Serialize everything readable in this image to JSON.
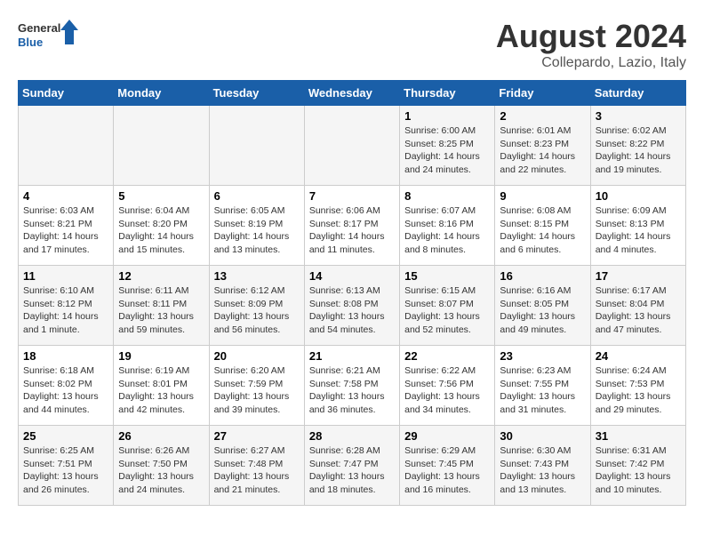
{
  "header": {
    "logo_general": "General",
    "logo_blue": "Blue",
    "title": "August 2024",
    "subtitle": "Collepardo, Lazio, Italy"
  },
  "days_of_week": [
    "Sunday",
    "Monday",
    "Tuesday",
    "Wednesday",
    "Thursday",
    "Friday",
    "Saturday"
  ],
  "weeks": [
    {
      "days": [
        {
          "num": "",
          "info": ""
        },
        {
          "num": "",
          "info": ""
        },
        {
          "num": "",
          "info": ""
        },
        {
          "num": "",
          "info": ""
        },
        {
          "num": "1",
          "info": "Sunrise: 6:00 AM\nSunset: 8:25 PM\nDaylight: 14 hours\nand 24 minutes."
        },
        {
          "num": "2",
          "info": "Sunrise: 6:01 AM\nSunset: 8:23 PM\nDaylight: 14 hours\nand 22 minutes."
        },
        {
          "num": "3",
          "info": "Sunrise: 6:02 AM\nSunset: 8:22 PM\nDaylight: 14 hours\nand 19 minutes."
        }
      ]
    },
    {
      "days": [
        {
          "num": "4",
          "info": "Sunrise: 6:03 AM\nSunset: 8:21 PM\nDaylight: 14 hours\nand 17 minutes."
        },
        {
          "num": "5",
          "info": "Sunrise: 6:04 AM\nSunset: 8:20 PM\nDaylight: 14 hours\nand 15 minutes."
        },
        {
          "num": "6",
          "info": "Sunrise: 6:05 AM\nSunset: 8:19 PM\nDaylight: 14 hours\nand 13 minutes."
        },
        {
          "num": "7",
          "info": "Sunrise: 6:06 AM\nSunset: 8:17 PM\nDaylight: 14 hours\nand 11 minutes."
        },
        {
          "num": "8",
          "info": "Sunrise: 6:07 AM\nSunset: 8:16 PM\nDaylight: 14 hours\nand 8 minutes."
        },
        {
          "num": "9",
          "info": "Sunrise: 6:08 AM\nSunset: 8:15 PM\nDaylight: 14 hours\nand 6 minutes."
        },
        {
          "num": "10",
          "info": "Sunrise: 6:09 AM\nSunset: 8:13 PM\nDaylight: 14 hours\nand 4 minutes."
        }
      ]
    },
    {
      "days": [
        {
          "num": "11",
          "info": "Sunrise: 6:10 AM\nSunset: 8:12 PM\nDaylight: 14 hours\nand 1 minute."
        },
        {
          "num": "12",
          "info": "Sunrise: 6:11 AM\nSunset: 8:11 PM\nDaylight: 13 hours\nand 59 minutes."
        },
        {
          "num": "13",
          "info": "Sunrise: 6:12 AM\nSunset: 8:09 PM\nDaylight: 13 hours\nand 56 minutes."
        },
        {
          "num": "14",
          "info": "Sunrise: 6:13 AM\nSunset: 8:08 PM\nDaylight: 13 hours\nand 54 minutes."
        },
        {
          "num": "15",
          "info": "Sunrise: 6:15 AM\nSunset: 8:07 PM\nDaylight: 13 hours\nand 52 minutes."
        },
        {
          "num": "16",
          "info": "Sunrise: 6:16 AM\nSunset: 8:05 PM\nDaylight: 13 hours\nand 49 minutes."
        },
        {
          "num": "17",
          "info": "Sunrise: 6:17 AM\nSunset: 8:04 PM\nDaylight: 13 hours\nand 47 minutes."
        }
      ]
    },
    {
      "days": [
        {
          "num": "18",
          "info": "Sunrise: 6:18 AM\nSunset: 8:02 PM\nDaylight: 13 hours\nand 44 minutes."
        },
        {
          "num": "19",
          "info": "Sunrise: 6:19 AM\nSunset: 8:01 PM\nDaylight: 13 hours\nand 42 minutes."
        },
        {
          "num": "20",
          "info": "Sunrise: 6:20 AM\nSunset: 7:59 PM\nDaylight: 13 hours\nand 39 minutes."
        },
        {
          "num": "21",
          "info": "Sunrise: 6:21 AM\nSunset: 7:58 PM\nDaylight: 13 hours\nand 36 minutes."
        },
        {
          "num": "22",
          "info": "Sunrise: 6:22 AM\nSunset: 7:56 PM\nDaylight: 13 hours\nand 34 minutes."
        },
        {
          "num": "23",
          "info": "Sunrise: 6:23 AM\nSunset: 7:55 PM\nDaylight: 13 hours\nand 31 minutes."
        },
        {
          "num": "24",
          "info": "Sunrise: 6:24 AM\nSunset: 7:53 PM\nDaylight: 13 hours\nand 29 minutes."
        }
      ]
    },
    {
      "days": [
        {
          "num": "25",
          "info": "Sunrise: 6:25 AM\nSunset: 7:51 PM\nDaylight: 13 hours\nand 26 minutes."
        },
        {
          "num": "26",
          "info": "Sunrise: 6:26 AM\nSunset: 7:50 PM\nDaylight: 13 hours\nand 24 minutes."
        },
        {
          "num": "27",
          "info": "Sunrise: 6:27 AM\nSunset: 7:48 PM\nDaylight: 13 hours\nand 21 minutes."
        },
        {
          "num": "28",
          "info": "Sunrise: 6:28 AM\nSunset: 7:47 PM\nDaylight: 13 hours\nand 18 minutes."
        },
        {
          "num": "29",
          "info": "Sunrise: 6:29 AM\nSunset: 7:45 PM\nDaylight: 13 hours\nand 16 minutes."
        },
        {
          "num": "30",
          "info": "Sunrise: 6:30 AM\nSunset: 7:43 PM\nDaylight: 13 hours\nand 13 minutes."
        },
        {
          "num": "31",
          "info": "Sunrise: 6:31 AM\nSunset: 7:42 PM\nDaylight: 13 hours\nand 10 minutes."
        }
      ]
    }
  ]
}
